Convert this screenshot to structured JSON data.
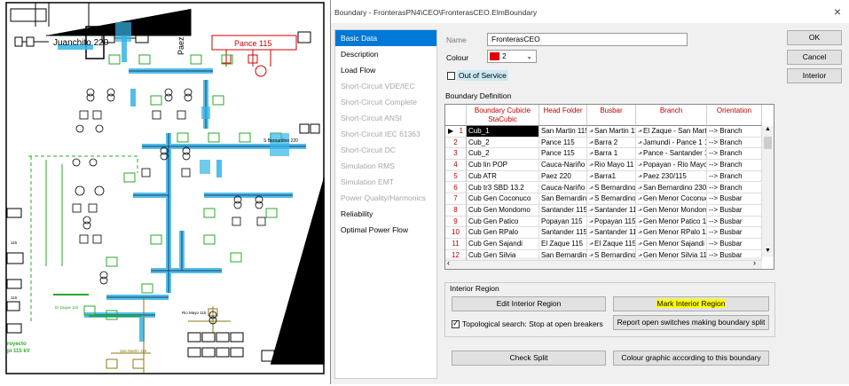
{
  "dialog": {
    "title": "Boundary - FronterasPN4\\CEO\\FronterasCEO.ElmBoundary",
    "close": "×",
    "nav": [
      {
        "label": "Basic Data",
        "state": "active"
      },
      {
        "label": "Description",
        "state": "normal"
      },
      {
        "label": "Load Flow",
        "state": "normal"
      },
      {
        "label": "Short-Circuit VDE/IEC",
        "state": "disabled"
      },
      {
        "label": "Short-Circuit Complete",
        "state": "disabled"
      },
      {
        "label": "Short-Circuit ANSI",
        "state": "disabled"
      },
      {
        "label": "Short-Circuit IEC 61363",
        "state": "disabled"
      },
      {
        "label": "Short-Circuit DC",
        "state": "disabled"
      },
      {
        "label": "Simulation RMS",
        "state": "disabled"
      },
      {
        "label": "Simulation EMT",
        "state": "disabled"
      },
      {
        "label": "Power Quality/Harmonics",
        "state": "disabled"
      },
      {
        "label": "Reliability",
        "state": "normal"
      },
      {
        "label": "Optimal Power Flow",
        "state": "normal"
      }
    ],
    "name_label": "Name",
    "name_value": "FronterasCEO",
    "colour_label": "Colour",
    "colour_value": "2",
    "colour_swatch": "#e00000",
    "out_of_service": "Out of Service",
    "boundary_definition": "Boundary Definition",
    "buttons": {
      "ok": "OK",
      "cancel": "Cancel",
      "interior": "Interior"
    },
    "table": {
      "headers": [
        "Boundary Cubicle StaCubic",
        "Head Folder",
        "Busbar",
        "Branch",
        "Orientation"
      ],
      "rows": [
        {
          "n": "1",
          "cubicle": "Cub_1",
          "folder": "San Martin 115",
          "busbar": "San Martin 11",
          "branch": "El Zaque - San Marti",
          "orient": "--> Branch"
        },
        {
          "n": "2",
          "cubicle": "Cub_2",
          "folder": "Pance 115",
          "busbar": "Barra 2",
          "branch": "Jamundi - Pance 1 1",
          "orient": "--> Branch"
        },
        {
          "n": "3",
          "cubicle": "Cub_2",
          "folder": "Pance 115",
          "busbar": "Barra 1",
          "branch": "Pance - Santander 1",
          "orient": "--> Branch"
        },
        {
          "n": "4",
          "cubicle": "Cub lin POP",
          "folder": "Cauca-Nariño",
          "busbar": "Rio Mayo 11",
          "branch": "Popayan - Rio Mayo 1",
          "orient": "--> Branch"
        },
        {
          "n": "5",
          "cubicle": "Cub ATR",
          "folder": "Paez 220",
          "busbar": "Barra1",
          "branch": "Paez 230/115",
          "orient": "--> Branch"
        },
        {
          "n": "6",
          "cubicle": "Cub tr3 SBD 13.2",
          "folder": "Cauca-Nariño",
          "busbar": "S Bernardino",
          "branch": "San Bernardino 230/",
          "orient": "--> Branch"
        },
        {
          "n": "7",
          "cubicle": "Cub Gen Coconuco",
          "folder": "San Bernardino",
          "busbar": "S Bernardino",
          "branch": "Gen Menor Coconuc",
          "orient": "--> Busbar"
        },
        {
          "n": "8",
          "cubicle": "Cub Gen Mondomo",
          "folder": "Santander 115",
          "busbar": "Santander 11",
          "branch": "Gen Menor Mondom",
          "orient": "--> Busbar"
        },
        {
          "n": "9",
          "cubicle": "Cub Gen Patico",
          "folder": "Popayan 115",
          "busbar": "Popayan 115",
          "branch": "Gen Menor Patico 1",
          "orient": "--> Busbar"
        },
        {
          "n": "10",
          "cubicle": "Cub Gen RPalo",
          "folder": "Santander 115",
          "busbar": "Santander 11",
          "branch": "Gen Menor RPalo 11",
          "orient": "--> Busbar"
        },
        {
          "n": "11",
          "cubicle": "Cub Gen Sajandi",
          "folder": "El Zaque 115",
          "busbar": "El Zaque 115",
          "branch": "Gen Menor Sajandi",
          "orient": "--> Busbar"
        },
        {
          "n": "12",
          "cubicle": "Cub Gen Silvia",
          "folder": "San Bernardino",
          "busbar": "S Bernardino",
          "branch": "Gen Menor Silvia 11",
          "orient": "--> Busbar"
        }
      ]
    },
    "interior_region": "Interior Region",
    "edit_interior": "Edit Interior Region",
    "mark_interior": "Mark Interior Region",
    "topological": "Topological search: Stop at open breakers",
    "report_open": "Report open switches making boundary split",
    "check_split": "Check Split",
    "colour_graphic": "Colour graphic according to this boundary"
  },
  "diagram": {
    "labels": {
      "juanchito": "Juanchito 220",
      "paez": "Paez 220",
      "pance": "Pance 115",
      "sbernardino": "S Bernardino 220",
      "proyecto": "royecto",
      "kv": "pi 115 kV",
      "riomayo": "Rio Mayo 115",
      "sanmartin": "San Martin 115",
      "zaque": "El Zaque 115",
      "left115": "115",
      "left116": "116"
    }
  }
}
